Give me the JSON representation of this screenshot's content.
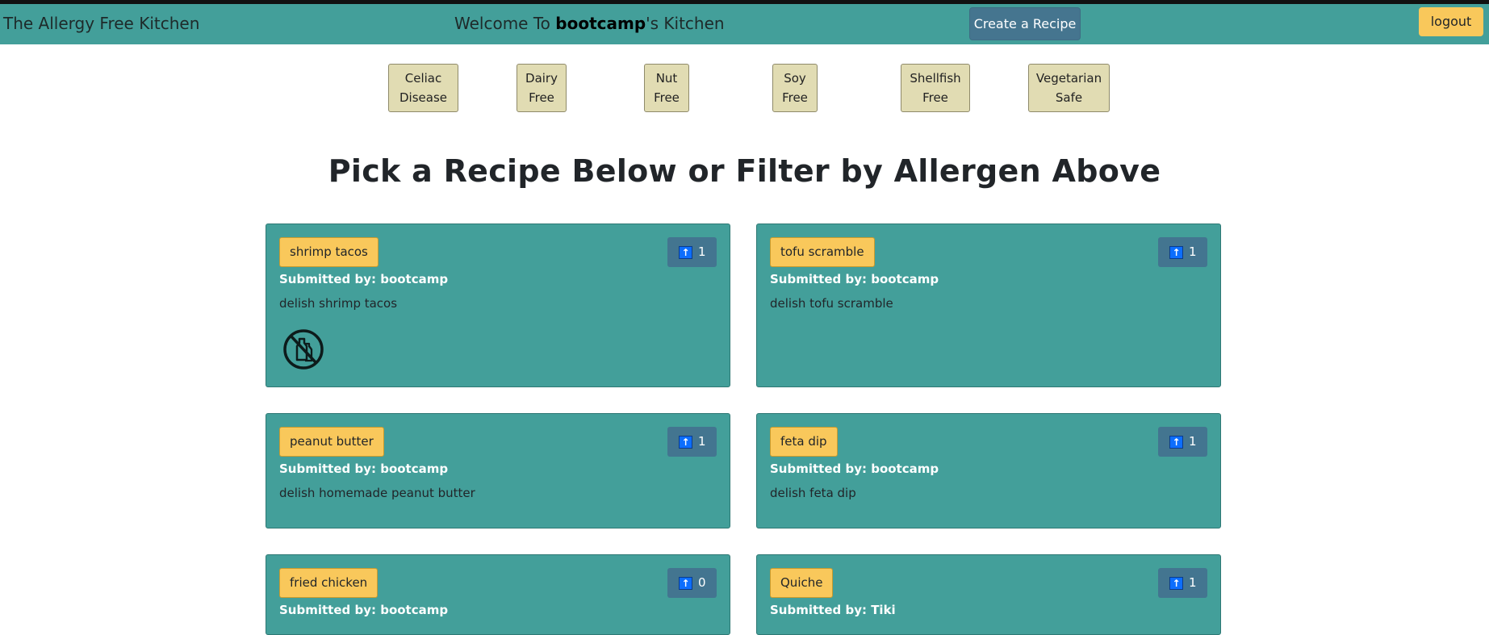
{
  "navbar": {
    "brand": "The Allergy Free Kitchen",
    "welcome_prefix": "Welcome To ",
    "username": "bootcamp",
    "welcome_suffix": "'s Kitchen",
    "create_label": "Create a Recipe",
    "logout_label": "logout"
  },
  "filters": [
    {
      "line1": "Celiac",
      "line2": "Disease"
    },
    {
      "line1": "Dairy",
      "line2": "Free"
    },
    {
      "line1": "Nut",
      "line2": "Free"
    },
    {
      "line1": "Soy",
      "line2": "Free"
    },
    {
      "line1": "Shellfish",
      "line2": "Free"
    },
    {
      "line1": "Vegetarian",
      "line2": "Safe"
    }
  ],
  "heading": "Pick a Recipe Below or Filter by Allergen Above",
  "recipes": [
    {
      "title": "shrimp tacos",
      "votes": "1",
      "submitted": "Submitted by: bootcamp",
      "description": "delish shrimp tacos",
      "icon": "no-dairy-icon"
    },
    {
      "title": "tofu scramble",
      "votes": "1",
      "submitted": "Submitted by: bootcamp",
      "description": "delish tofu scramble"
    },
    {
      "title": "peanut butter",
      "votes": "1",
      "submitted": "Submitted by: bootcamp",
      "description": "delish homemade peanut butter"
    },
    {
      "title": "feta dip",
      "votes": "1",
      "submitted": "Submitted by: bootcamp",
      "description": "delish feta dip"
    },
    {
      "title": "fried chicken",
      "votes": "0",
      "submitted": "Submitted by: bootcamp",
      "description": ""
    },
    {
      "title": "Quiche",
      "votes": "1",
      "submitted": "Submitted by: Tiki",
      "description": ""
    }
  ],
  "colors": {
    "accent": "#439f9a",
    "button_yellow": "#f9c85b",
    "button_steel": "#437590"
  },
  "icons": {
    "vote": "arrow-up-icon"
  }
}
